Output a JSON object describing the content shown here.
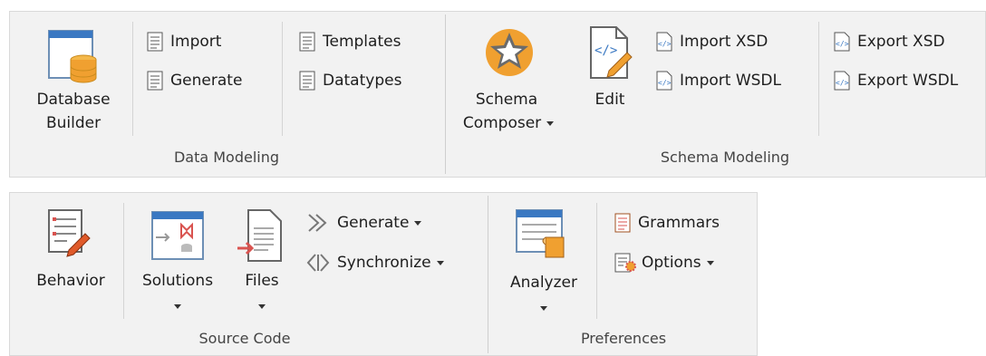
{
  "data_modeling": {
    "group_label": "Data Modeling",
    "database_builder": {
      "line1": "Database",
      "line2": "Builder"
    },
    "import": "Import",
    "generate": "Generate",
    "templates": "Templates",
    "datatypes": "Datatypes"
  },
  "schema_modeling": {
    "group_label": "Schema Modeling",
    "schema_composer": {
      "line1": "Schema",
      "line2": "Composer"
    },
    "edit": "Edit",
    "import_xsd": "Import XSD",
    "import_wsdl": "Import WSDL",
    "export_xsd": "Export XSD",
    "export_wsdl": "Export WSDL"
  },
  "source_code": {
    "group_label": "Source Code",
    "behavior": "Behavior",
    "solutions": "Solutions",
    "files": "Files",
    "generate": "Generate",
    "synchronize": "Synchronize"
  },
  "preferences": {
    "group_label": "Preferences",
    "analyzer": "Analyzer",
    "grammars": "Grammars",
    "options": "Options"
  },
  "colors": {
    "ribbon_bg": "#f2f2f2",
    "accent_orange": "#f0a030",
    "accent_blue": "#3a78c2",
    "accent_red": "#d9534f"
  }
}
